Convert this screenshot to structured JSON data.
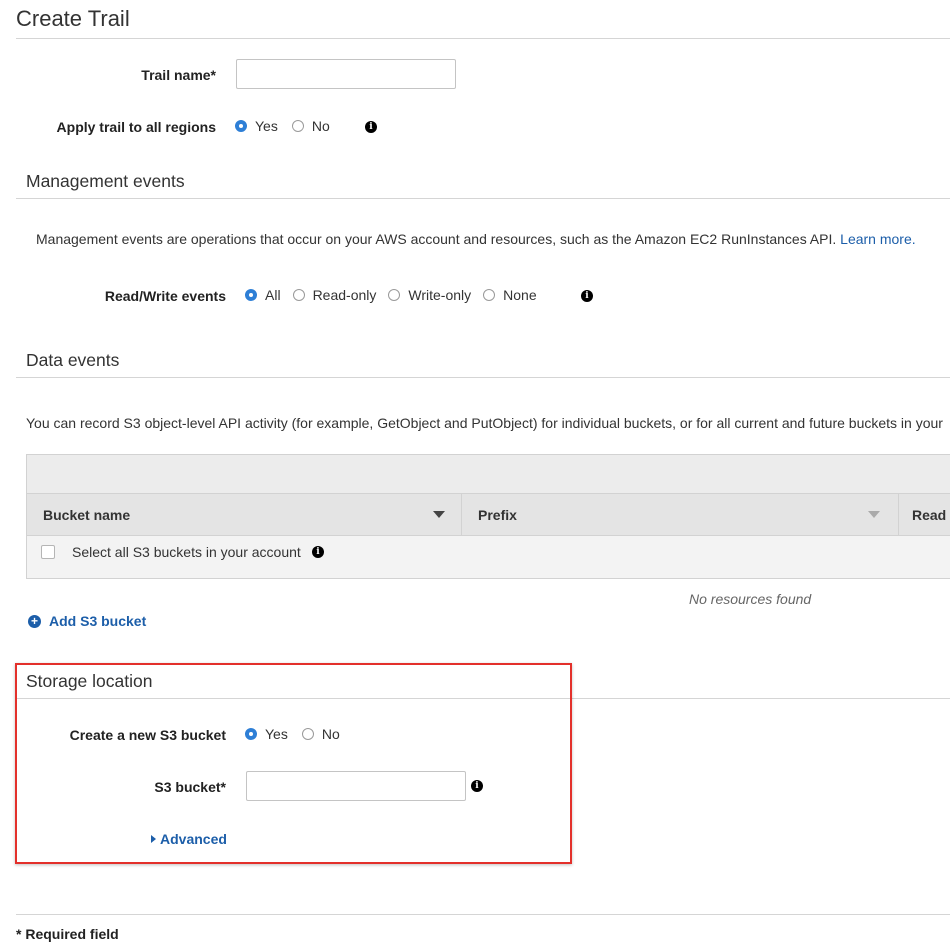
{
  "page": {
    "title": "Create Trail"
  },
  "trail": {
    "name_label": "Trail name*",
    "name_value": "",
    "apply_label": "Apply trail to all regions",
    "apply_options": [
      "Yes",
      "No"
    ],
    "apply_selected": "Yes"
  },
  "management": {
    "title": "Management events",
    "description": "Management events are operations that occur on your AWS account and resources, such as the Amazon EC2 RunInstances API.",
    "learn_more": "Learn more.",
    "rw_label": "Read/Write events",
    "rw_options": [
      "All",
      "Read-only",
      "Write-only",
      "None"
    ],
    "rw_selected": "All"
  },
  "data_events": {
    "title": "Data events",
    "description": "You can record S3 object-level API activity (for example, GetObject and PutObject) for individual buckets, or for all current and future buckets in your",
    "columns": [
      "Bucket name",
      "Prefix",
      "Read"
    ],
    "select_all_label": "Select all S3 buckets in your account",
    "select_all_checked": false,
    "empty_text": "No resources found",
    "add_bucket_label": "Add S3 bucket"
  },
  "storage": {
    "title": "Storage location",
    "create_label": "Create a new S3 bucket",
    "create_options": [
      "Yes",
      "No"
    ],
    "create_selected": "Yes",
    "bucket_label": "S3 bucket*",
    "bucket_value": "",
    "advanced_label": "Advanced"
  },
  "footer": {
    "required_note": "* Required field"
  },
  "colors": {
    "accent": "#2e7fd6",
    "link": "#1c5ea9",
    "highlight": "#e3302b"
  },
  "icons": [
    "info-icon",
    "plus-circle-icon",
    "caret-down-icon",
    "caret-right-icon"
  ]
}
